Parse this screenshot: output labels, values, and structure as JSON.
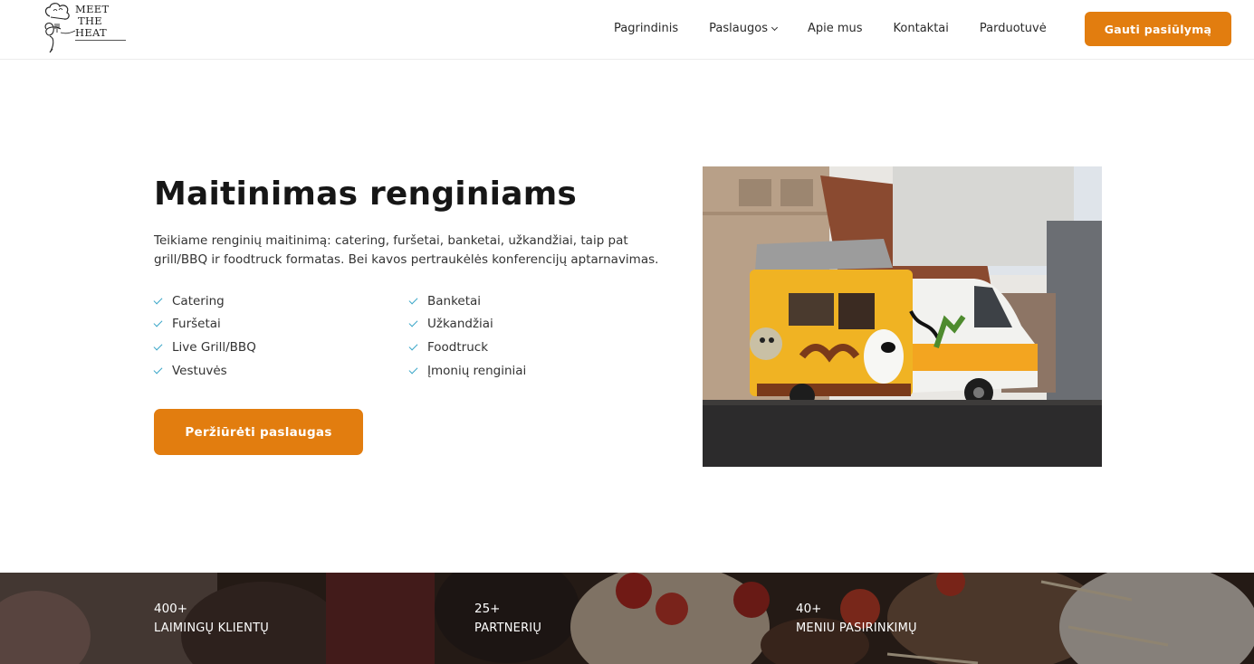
{
  "header": {
    "logo": {
      "line1": "MEET",
      "line2": "THE",
      "line3": "HEAT"
    },
    "nav": [
      {
        "label": "Pagrindinis"
      },
      {
        "label": "Paslaugos",
        "has_dropdown": true
      },
      {
        "label": "Apie mus"
      },
      {
        "label": "Kontaktai"
      },
      {
        "label": "Parduotuvė"
      }
    ],
    "cta_label": "Gauti pasiūlymą"
  },
  "hero": {
    "title": "Maitinimas renginiams",
    "description": "Teikiame renginių maitinimą: catering, furšetai, banketai, užkandžiai, taip pat grill/BBQ ir foodtruck formatas. Bei kavos pertraukėlės konferencijų aptarnavimas.",
    "features_left": [
      "Catering",
      "Furšetai",
      "Live Grill/BBQ",
      "Vestuvės"
    ],
    "features_right": [
      "Banketai",
      "Užkandžiai",
      "Foodtruck",
      "Įmonių renginiai"
    ],
    "button_label": "Peržiūrėti paslaugas",
    "image_alt": "food truck photo"
  },
  "stats": [
    {
      "value": "400+",
      "label": "LAIMINGŲ KLIENTŲ"
    },
    {
      "value": "25+",
      "label": "PARTNERIŲ"
    },
    {
      "value": "40+",
      "label": "MENIU PASIRINKIMŲ"
    }
  ],
  "colors": {
    "accent": "#e27d0f",
    "check": "#3aa6c8",
    "text": "#161616"
  }
}
